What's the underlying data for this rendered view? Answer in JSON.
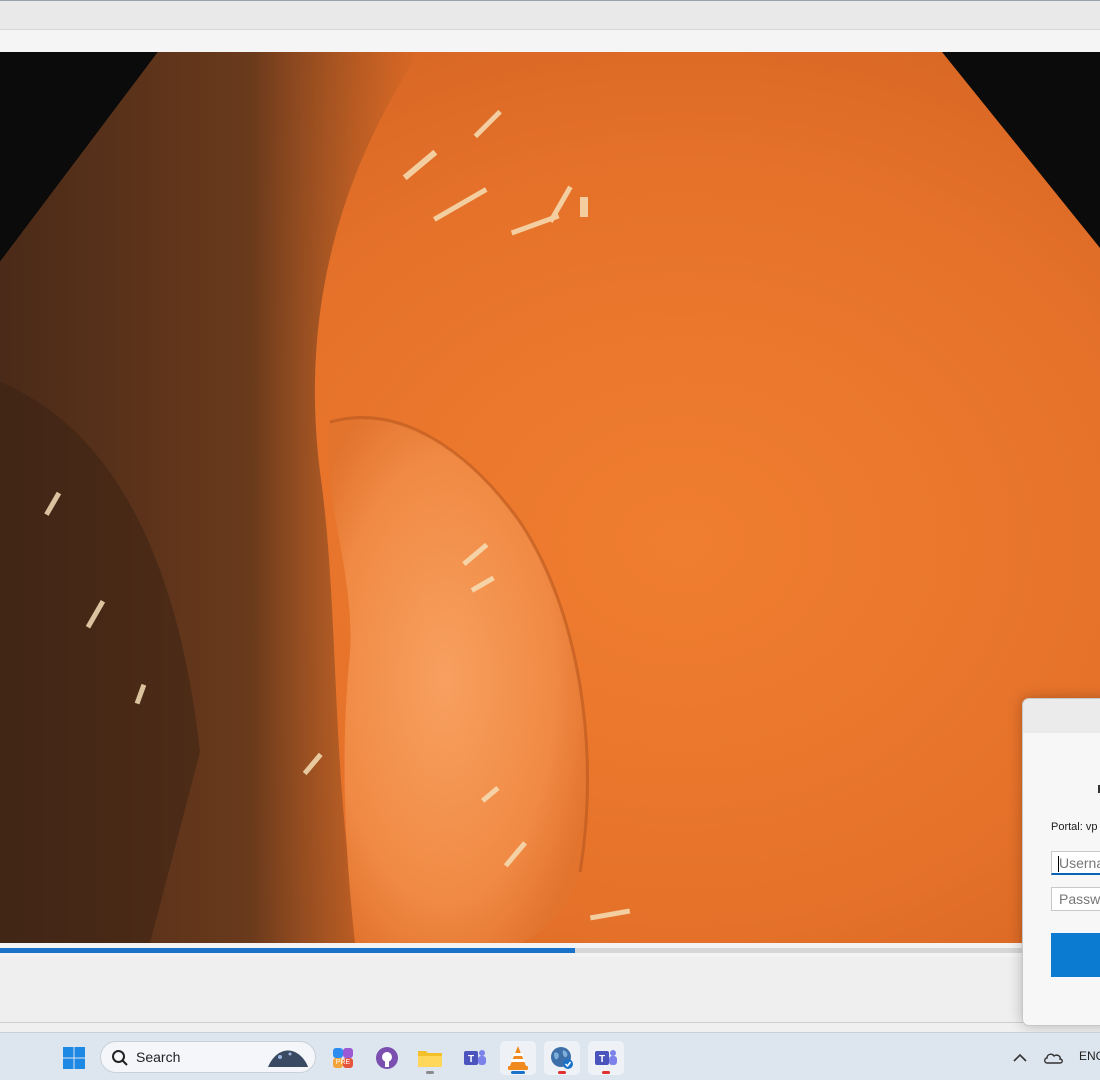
{
  "window": {
    "title": ""
  },
  "player": {
    "progress_fraction": 0.523
  },
  "dialog": {
    "portal_label": "Portal: vp",
    "username_placeholder": "Userna",
    "password_placeholder": "Passwo",
    "signin_label": ""
  },
  "taskbar": {
    "search_placeholder": "Search",
    "tray_language": "ENG",
    "icons": [
      "windows-start-icon",
      "search-icon",
      "copilot-icon",
      "github-icon",
      "file-explorer-icon",
      "teams-icon",
      "vlc-icon",
      "vpn-globe-icon",
      "teams-icon",
      "chevron-up-icon",
      "onedrive-icon"
    ]
  },
  "colors": {
    "accent": "#0a7bd1",
    "progress": "#1a73c9",
    "tissue": "#e8782c"
  }
}
